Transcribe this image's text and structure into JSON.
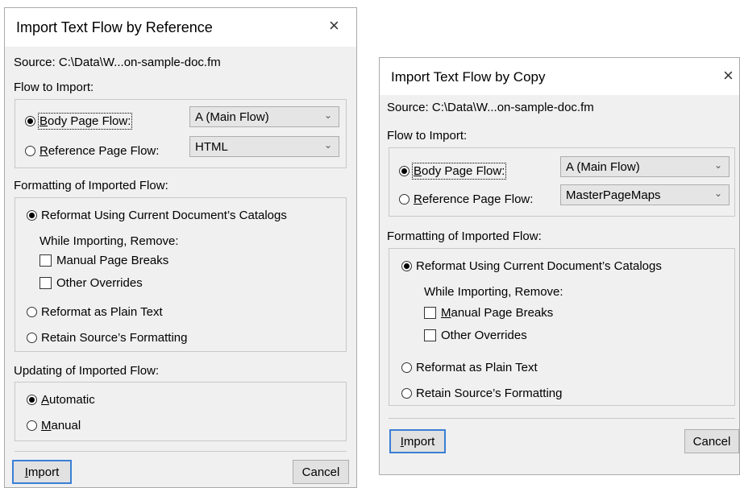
{
  "ref_dialog": {
    "title": "Import Text Flow by Reference",
    "close_symbol": "×",
    "source": "Source:  C:\\Data\\W...on-sample-doc.fm",
    "flow_to_import_label": "Flow to Import:",
    "body_page_flow_label": "Body Page Flow:",
    "body_page_flow_value": "A (Main Flow)",
    "reference_page_flow_label": "Reference Page Flow:",
    "reference_page_flow_value": "HTML",
    "formatting_label": "Formatting of Imported Flow:",
    "reformat_current_label": "Reformat Using Current Document’s Catalogs",
    "while_importing_label": "While Importing, Remove:",
    "manual_page_breaks_label": "Manual Page Breaks",
    "other_overrides_label": "Other Overrides",
    "reformat_plain_label": "Reformat as Plain Text",
    "retain_source_label": "Retain Source’s Formatting",
    "updating_label": "Updating of Imported Flow:",
    "automatic_label": "Automatic",
    "manual_label": "Manual",
    "import_button": "Import",
    "cancel_button": "Cancel"
  },
  "copy_dialog": {
    "title": "Import Text Flow by Copy",
    "close_symbol": "×",
    "source": "Source:  C:\\Data\\W...on-sample-doc.fm",
    "flow_to_import_label": "Flow to Import:",
    "body_page_flow_label": "Body Page Flow:",
    "body_page_flow_value": "A (Main Flow)",
    "reference_page_flow_label": "Reference Page Flow:",
    "reference_page_flow_value": "MasterPageMaps",
    "formatting_label": "Formatting of Imported Flow:",
    "reformat_current_label": "Reformat Using Current Document’s Catalogs",
    "while_importing_label": "While Importing, Remove:",
    "manual_page_breaks_label": "Manual Page Breaks",
    "other_overrides_label": "Other Overrides",
    "reformat_plain_label": "Reformat as Plain Text",
    "retain_source_label": "Retain Source’s Formatting",
    "import_button": "Import",
    "cancel_button": "Cancel"
  },
  "icons": {
    "close": "close-icon",
    "dropdown": "chevron-down-icon"
  },
  "colors": {
    "dialog_bg": "#f0f0f0",
    "titlebar_bg": "#ffffff",
    "default_button_border": "#3a7fd5"
  }
}
